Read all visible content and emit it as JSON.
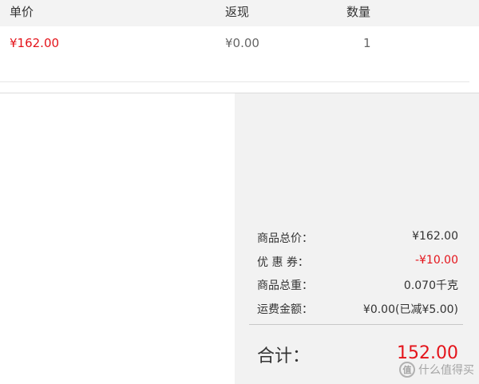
{
  "table": {
    "headers": {
      "unit_price": "单价",
      "cashback": "返现",
      "quantity": "数量"
    },
    "item": {
      "unit_price": "¥162.00",
      "cashback": "¥0.00",
      "quantity": "1"
    }
  },
  "summary": {
    "goods_total_label": "商品总价：",
    "goods_total_value": "¥162.00",
    "coupon_label": "优 惠 券：",
    "coupon_value": "-¥10.00",
    "weight_label": "商品总重：",
    "weight_value": "0.070千克",
    "shipping_label": "运费金额：",
    "shipping_value": "¥0.00(已减¥5.00)",
    "total_label": "合计：",
    "total_value": "152.00"
  },
  "watermark": {
    "text": "什么值得买",
    "logo_glyph": "值"
  },
  "colors": {
    "accent_red": "#e4141b",
    "header_bg": "#f3f3f3",
    "summary_bg": "#f2f2f2"
  }
}
